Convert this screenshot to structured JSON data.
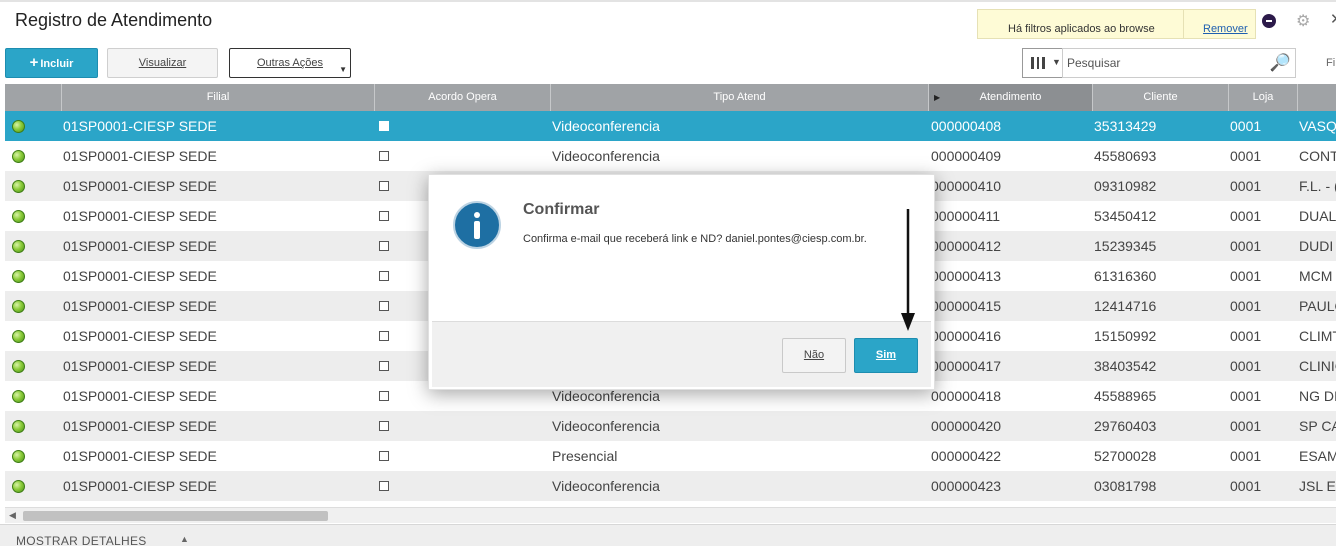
{
  "app": {
    "title": "Registro de Atendimento"
  },
  "filter_notice": {
    "message": "Há filtros aplicados ao browse",
    "remove_label": "Remover"
  },
  "toolbar": {
    "include_label": "Incluir",
    "view_label": "Visualizar",
    "other_actions_label": "Outras Ações",
    "search_placeholder": "Pesquisar",
    "filter_label": "Fi"
  },
  "grid": {
    "columns": [
      "Filial",
      "Acordo Opera",
      "Tipo Atend",
      "Atendimento",
      "Cliente",
      "Loja"
    ],
    "rows": [
      {
        "filial": "01SP0001-CIESP SEDE",
        "tipo": "Videoconferencia",
        "atendimento": "000000408",
        "cliente": "35313429",
        "loja": "0001",
        "nome": "VASQ"
      },
      {
        "filial": "01SP0001-CIESP SEDE",
        "tipo": "Videoconferencia",
        "atendimento": "000000409",
        "cliente": "45580693",
        "loja": "0001",
        "nome": "CONT"
      },
      {
        "filial": "01SP0001-CIESP SEDE",
        "tipo": "",
        "atendimento": "000000410",
        "cliente": "09310982",
        "loja": "0001",
        "nome": "F.L. - ("
      },
      {
        "filial": "01SP0001-CIESP SEDE",
        "tipo": "",
        "atendimento": "000000411",
        "cliente": "53450412",
        "loja": "0001",
        "nome": "DUAL"
      },
      {
        "filial": "01SP0001-CIESP SEDE",
        "tipo": "",
        "atendimento": "000000412",
        "cliente": "15239345",
        "loja": "0001",
        "nome": "DUDI"
      },
      {
        "filial": "01SP0001-CIESP SEDE",
        "tipo": "",
        "atendimento": "000000413",
        "cliente": "61316360",
        "loja": "0001",
        "nome": "MCM"
      },
      {
        "filial": "01SP0001-CIESP SEDE",
        "tipo": "",
        "atendimento": "000000415",
        "cliente": "12414716",
        "loja": "0001",
        "nome": "PAULO"
      },
      {
        "filial": "01SP0001-CIESP SEDE",
        "tipo": "",
        "atendimento": "000000416",
        "cliente": "15150992",
        "loja": "0001",
        "nome": "CLIMT"
      },
      {
        "filial": "01SP0001-CIESP SEDE",
        "tipo": "",
        "atendimento": "000000417",
        "cliente": "38403542",
        "loja": "0001",
        "nome": "CLINIC"
      },
      {
        "filial": "01SP0001-CIESP SEDE",
        "tipo": "Videoconferencia",
        "atendimento": "000000418",
        "cliente": "45588965",
        "loja": "0001",
        "nome": "NG DI"
      },
      {
        "filial": "01SP0001-CIESP SEDE",
        "tipo": "Videoconferencia",
        "atendimento": "000000420",
        "cliente": "29760403",
        "loja": "0001",
        "nome": "SP CA"
      },
      {
        "filial": "01SP0001-CIESP SEDE",
        "tipo": "Presencial",
        "atendimento": "000000422",
        "cliente": "52700028",
        "loja": "0001",
        "nome": "ESAM"
      },
      {
        "filial": "01SP0001-CIESP SEDE",
        "tipo": "Videoconferencia",
        "atendimento": "000000423",
        "cliente": "03081798",
        "loja": "0001",
        "nome": "JSL E"
      }
    ]
  },
  "footer": {
    "details_label": "MOSTRAR DETALHES"
  },
  "dialog": {
    "title": "Confirmar",
    "message": "Confirma e-mail que receberá link e ND? daniel.pontes@ciesp.com.br.",
    "no_label": "Não",
    "yes_label": "Sim"
  },
  "colors": {
    "accent": "#2ba5c8",
    "header_bg": "#a0a3a6",
    "status_ok": "#8ccc3a"
  },
  "icons": [
    "plus-icon",
    "gear-icon",
    "close-icon",
    "search-icon",
    "columns-icon",
    "info-icon",
    "status-led-icon"
  ]
}
